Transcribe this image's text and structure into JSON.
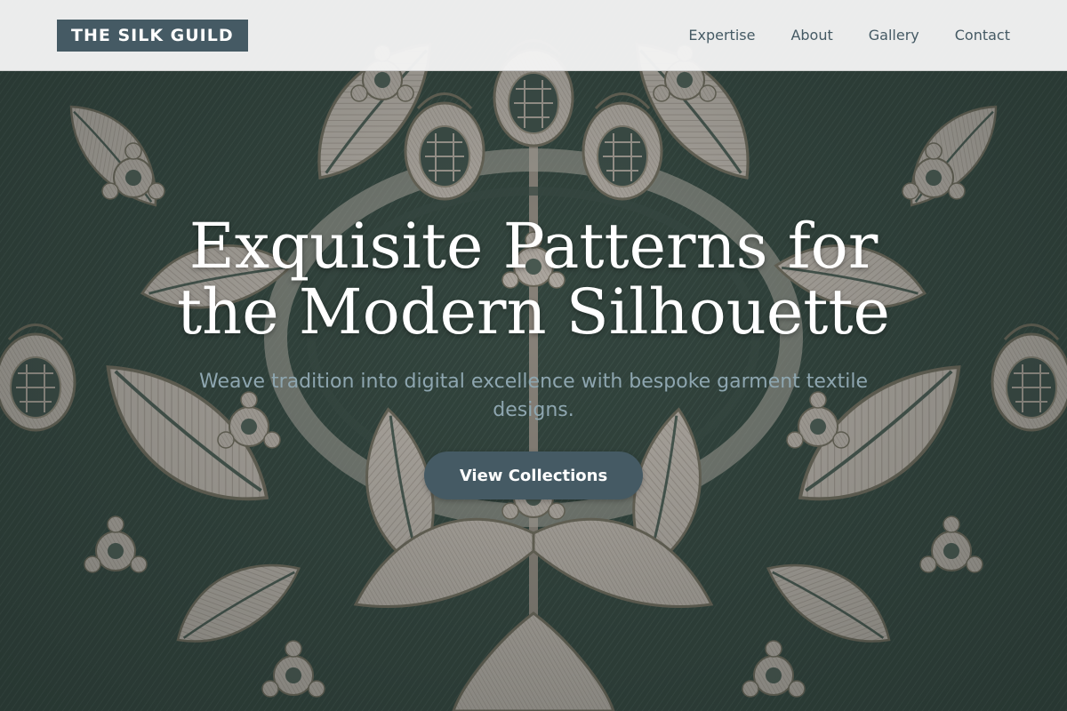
{
  "header": {
    "logo_text": "THE SILK GUILD",
    "nav": [
      {
        "label": "Expertise"
      },
      {
        "label": "About"
      },
      {
        "label": "Gallery"
      },
      {
        "label": "Contact"
      }
    ]
  },
  "hero": {
    "title": "Exquisite Patterns for the Modern Silhouette",
    "subtitle": "Weave tradition into digital excellence with bespoke garment textile designs.",
    "cta_label": "View Collections",
    "background": "damask-textile-pattern"
  },
  "colors": {
    "brand": "#455a64",
    "header_bg": "#f4f4f4",
    "subtitle": "#8ea6b0",
    "textile_dark": "#34463f",
    "textile_light": "#bcb4ac"
  }
}
